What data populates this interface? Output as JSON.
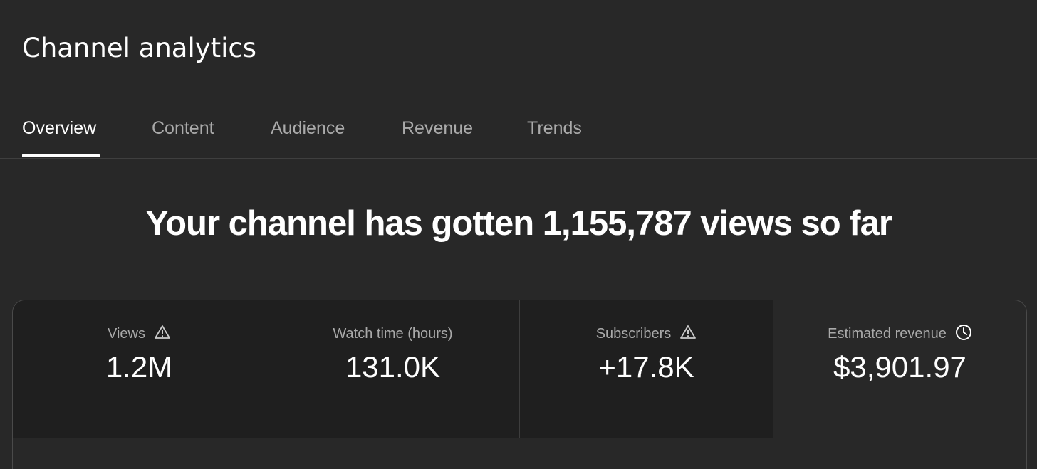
{
  "header": {
    "title": "Channel analytics"
  },
  "tabs": [
    {
      "label": "Overview",
      "active": true
    },
    {
      "label": "Content",
      "active": false
    },
    {
      "label": "Audience",
      "active": false
    },
    {
      "label": "Revenue",
      "active": false
    },
    {
      "label": "Trends",
      "active": false
    }
  ],
  "headline": "Your channel has gotten 1,155,787 views so far",
  "metrics": [
    {
      "label": "Views",
      "value": "1.2M",
      "icon": "warning-icon"
    },
    {
      "label": "Watch time (hours)",
      "value": "131.0K",
      "icon": ""
    },
    {
      "label": "Subscribers",
      "value": "+17.8K",
      "icon": "warning-icon"
    },
    {
      "label": "Estimated revenue",
      "value": "$3,901.97",
      "icon": "clock-icon"
    }
  ],
  "colors": {
    "background": "#282828",
    "selected_card": "#1f1f1f",
    "text_primary": "#ffffff",
    "text_secondary": "#aaaaaa"
  }
}
